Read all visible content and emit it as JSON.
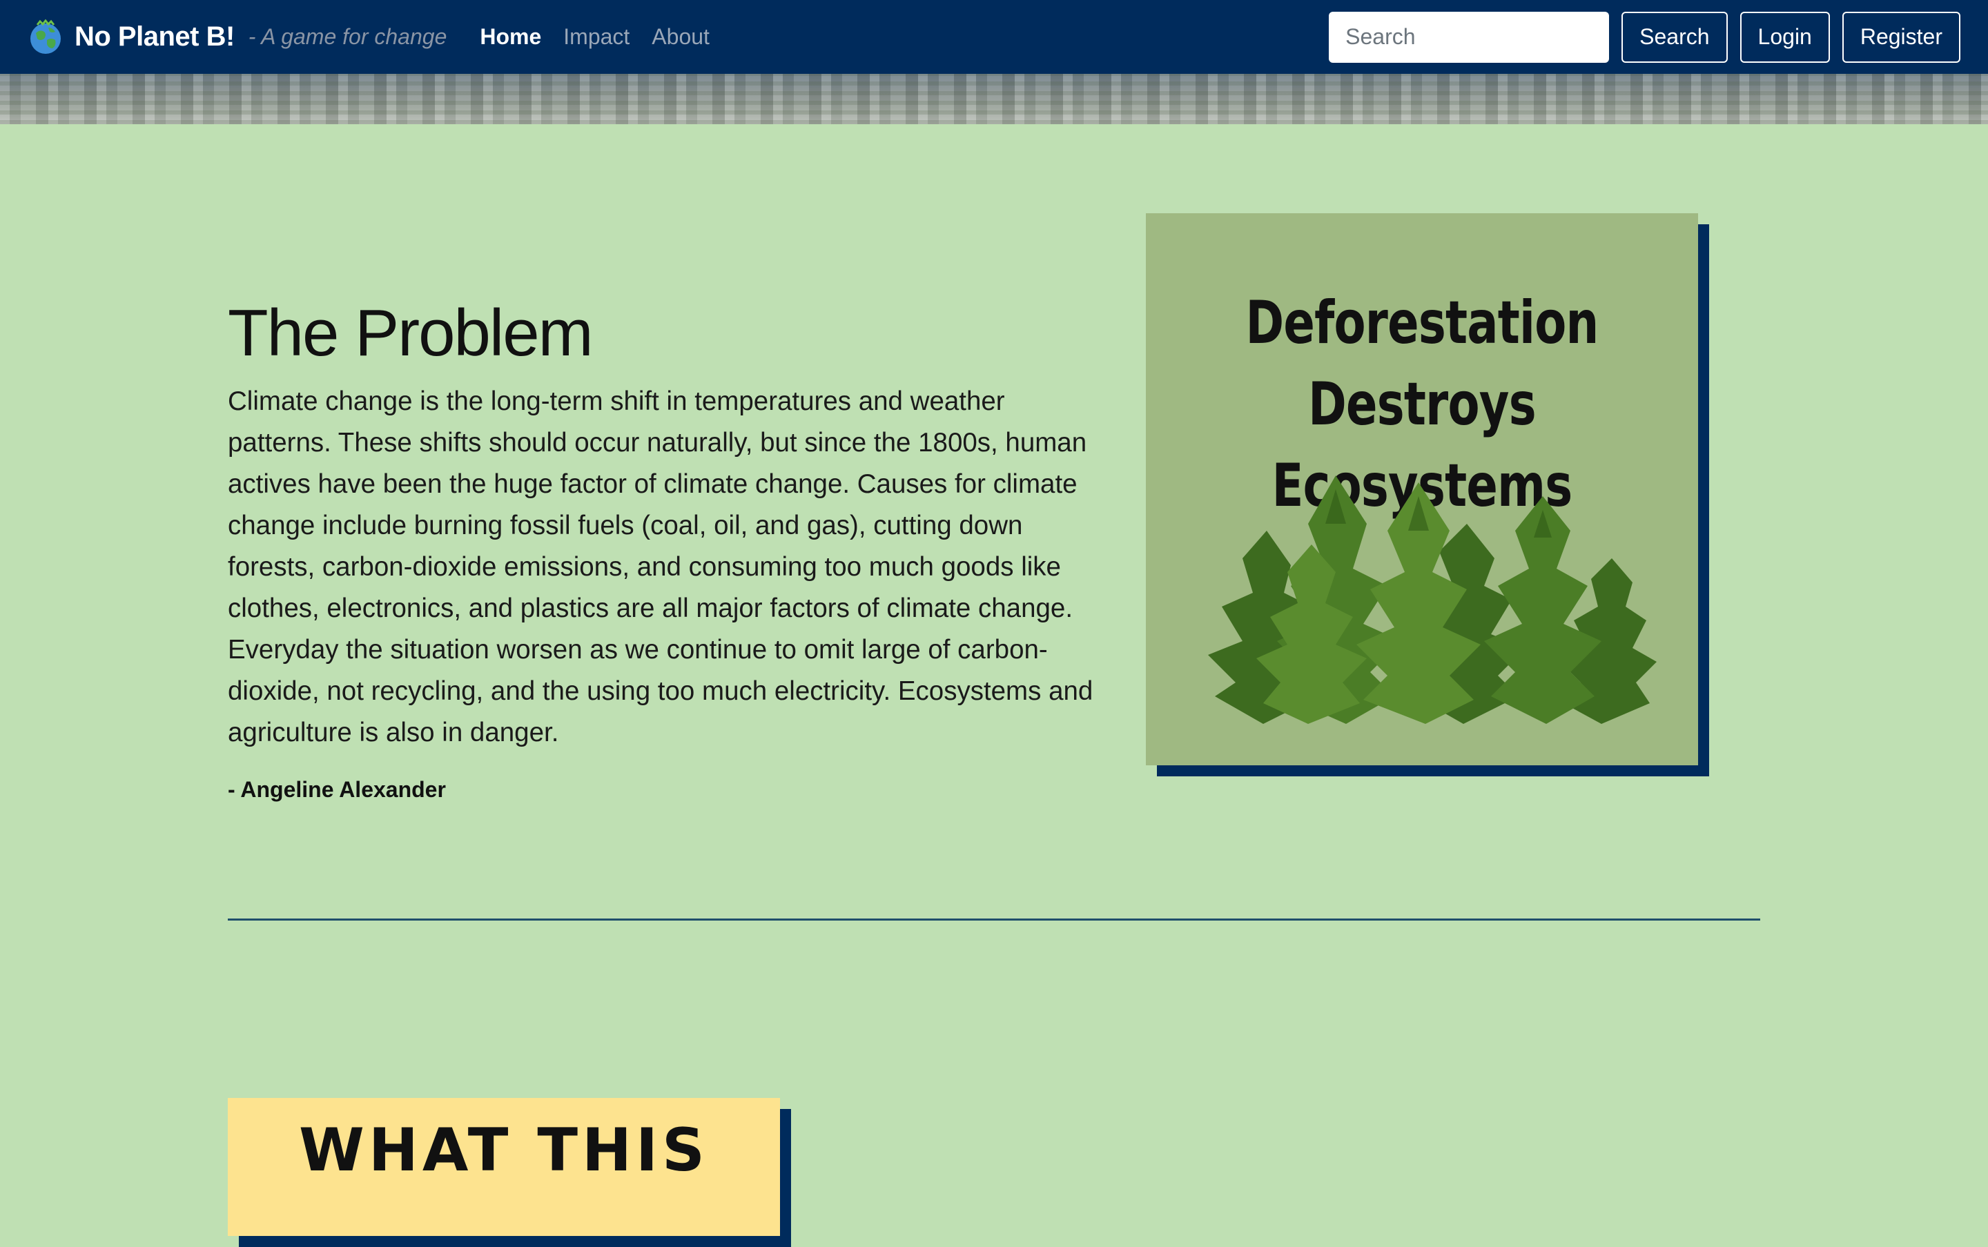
{
  "navbar": {
    "brand_name": "No Planet B!",
    "brand_tagline": "- A game for change",
    "brand_logo_icon": "earth-globe-icon",
    "links": [
      {
        "label": "Home",
        "active": true
      },
      {
        "label": "Impact",
        "active": false
      },
      {
        "label": "About",
        "active": false
      }
    ],
    "search_placeholder": "Search",
    "search_button": "Search",
    "login_button": "Login",
    "register_button": "Register"
  },
  "problem": {
    "heading": "The Problem",
    "body": "Climate change is the long-term shift in temperatures and weather patterns. These shifts should occur naturally, but since the 1800s, human actives have been the huge factor of climate change. Causes for climate change include burning fossil fuels (coal, oil, and gas), cutting down forests, carbon-dioxide emissions, and consuming too much goods like clothes, electronics, and plastics are all major factors of climate change. Everyday the situation worsen as we continue to omit large of carbon-dioxide, not recycling, and the using too much electricity. Ecosystems and agriculture is also in danger.",
    "author": "- Angeline Alexander"
  },
  "poster": {
    "title_line1": "Deforestation Destroys",
    "title_line2": "Ecosystems",
    "background": "#9fb982",
    "illustration": "pine-trees-illustration"
  },
  "poster2": {
    "title": "WHAT THIS",
    "background": "#fde38f"
  },
  "colors": {
    "navbar": "#002b5c",
    "page_background": "#bfe0b3",
    "poster_shadow": "#002b5c"
  }
}
